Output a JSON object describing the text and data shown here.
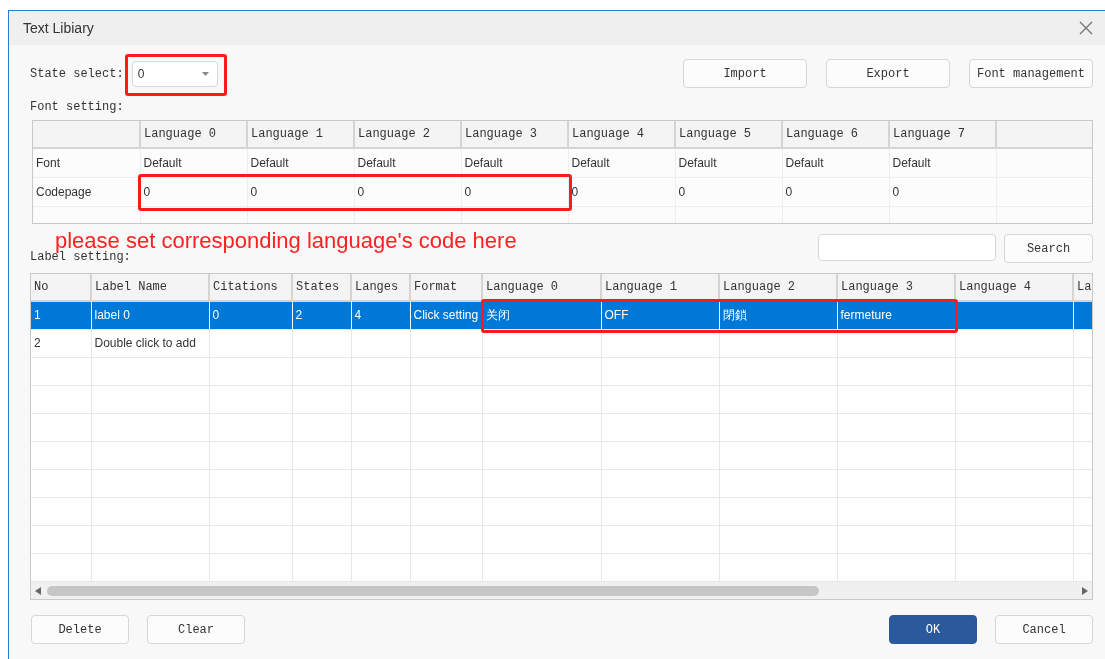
{
  "window": {
    "title": "Text Libiary"
  },
  "state_select": {
    "label": "State select:",
    "value": "0",
    "highlighted": true
  },
  "toolbar_buttons": [
    "Import",
    "Export",
    "Font management"
  ],
  "font_setting": {
    "label": "Font setting:",
    "columns": [
      "Language 0",
      "Language 1",
      "Language 2",
      "Language 3",
      "Language 4",
      "Language 5",
      "Language 6",
      "Language 7"
    ],
    "rows": [
      {
        "label": "Font",
        "cells": [
          {
            "text": "Default",
            "highlighted": false
          },
          {
            "text": "Default",
            "highlighted": false
          },
          {
            "text": "Default",
            "highlighted": false
          },
          {
            "text": "Default",
            "highlighted": false
          },
          {
            "text": "Default",
            "highlighted": false
          },
          {
            "text": "Default",
            "highlighted": false
          },
          {
            "text": "Default",
            "highlighted": false
          },
          {
            "text": "Default",
            "highlighted": false
          }
        ]
      },
      {
        "label": "Codepage",
        "cells": [
          {
            "text": "0",
            "highlighted": true
          },
          {
            "text": "0",
            "highlighted": true
          },
          {
            "text": "0",
            "highlighted": true
          },
          {
            "text": "0",
            "highlighted": true
          },
          {
            "text": "0",
            "highlighted": false
          },
          {
            "text": "0",
            "highlighted": false
          },
          {
            "text": "0",
            "highlighted": false
          },
          {
            "text": "0",
            "highlighted": false
          }
        ]
      }
    ]
  },
  "annotation": "please set corresponding language's code here",
  "search": {
    "button": "Search"
  },
  "label_setting": {
    "label": "Label setting:",
    "columns": [
      "No",
      "Label Name",
      "Citations",
      "States",
      "Langes",
      "Format",
      "Language 0",
      "Language 1",
      "Language 2",
      "Language 3",
      "Language 4",
      "La"
    ],
    "rows": [
      {
        "selected": true,
        "cells": [
          {
            "text": "1",
            "highlighted": false
          },
          {
            "text": "label 0",
            "highlighted": false
          },
          {
            "text": "0",
            "highlighted": false
          },
          {
            "text": "2",
            "highlighted": false
          },
          {
            "text": "4",
            "highlighted": false
          },
          {
            "text": "Click setting",
            "highlighted": false
          },
          {
            "text": "关闭",
            "highlighted": true
          },
          {
            "text": "OFF",
            "highlighted": true
          },
          {
            "text": "閉鎖",
            "highlighted": true
          },
          {
            "text": "fermeture",
            "highlighted": true
          }
        ]
      },
      {
        "selected": false,
        "cells": [
          {
            "text": "2",
            "highlighted": false
          },
          {
            "text": "Double click to add",
            "highlighted": false
          }
        ]
      }
    ]
  },
  "footer_buttons": [
    {
      "label": "Delete",
      "kind": "plain"
    },
    {
      "label": "Clear",
      "kind": "plain"
    },
    {
      "label": "OK",
      "kind": "primary"
    },
    {
      "label": "Cancel",
      "kind": "plain"
    }
  ]
}
